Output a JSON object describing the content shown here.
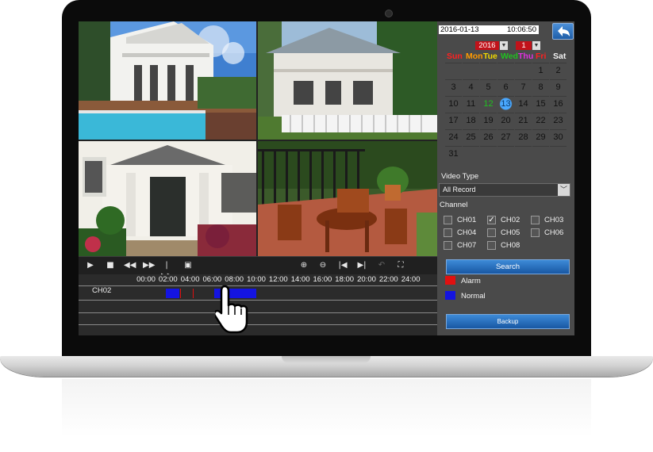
{
  "datetime": {
    "date": "2016-01-13",
    "time": "10:06:50"
  },
  "calendar": {
    "year": "2016",
    "month": "1",
    "weekdays": [
      {
        "label": "Sun",
        "color": "#ff2020"
      },
      {
        "label": "Mon",
        "color": "#ff9a00"
      },
      {
        "label": "Tue",
        "color": "#f0d800"
      },
      {
        "label": "Wed",
        "color": "#20c020"
      },
      {
        "label": "Thu",
        "color": "#e030e0"
      },
      {
        "label": "Fri",
        "color": "#ff2020"
      },
      {
        "label": "Sat",
        "color": "#f4f4f4"
      }
    ],
    "weeks": [
      [
        "",
        "",
        "",
        "",
        "",
        "1",
        "2"
      ],
      [
        "3",
        "4",
        "5",
        "6",
        "7",
        "8",
        "9"
      ],
      [
        "10",
        "11",
        "12",
        "13",
        "14",
        "15",
        "16"
      ],
      [
        "17",
        "18",
        "19",
        "20",
        "21",
        "22",
        "23"
      ],
      [
        "24",
        "25",
        "26",
        "27",
        "28",
        "29",
        "30"
      ],
      [
        "31",
        "",
        "",
        "",
        "",
        "",
        ""
      ]
    ],
    "record_day": "12",
    "record_day_color": "#20c020",
    "selected_day": "13"
  },
  "video_type": {
    "label": "Video Type",
    "value": "All Record"
  },
  "channel": {
    "label": "Channel",
    "items": [
      {
        "name": "CH01",
        "checked": false
      },
      {
        "name": "CH02",
        "checked": true
      },
      {
        "name": "CH03",
        "checked": false
      },
      {
        "name": "CH04",
        "checked": false
      },
      {
        "name": "CH05",
        "checked": false
      },
      {
        "name": "CH06",
        "checked": false
      },
      {
        "name": "CH07",
        "checked": false
      },
      {
        "name": "CH08",
        "checked": false
      }
    ]
  },
  "search_label": "Search",
  "backup_label": "Backup",
  "legend": [
    {
      "label": "Alarm",
      "color": "#e01010"
    },
    {
      "label": "Normal",
      "color": "#1414e0"
    }
  ],
  "timeline": {
    "hours": [
      "00:00",
      "02:00",
      "04:00",
      "06:00",
      "08:00",
      "10:00",
      "12:00",
      "14:00",
      "16:00",
      "18:00",
      "20:00",
      "22:00",
      "24:00"
    ],
    "channel_label": "CH02",
    "segments": [
      {
        "type": "normal",
        "start_hour": 1.8,
        "end_hour": 3.0
      },
      {
        "type": "alarm",
        "start_hour": 3.1,
        "end_hour": 4.2
      },
      {
        "type": "normal",
        "start_hour": 6.2,
        "end_hour": 10.0
      }
    ]
  },
  "controls": {
    "icons": [
      "play-icon",
      "stop-icon",
      "rewind-icon",
      "fast-forward-icon",
      "step-forward-icon",
      "snapshot-icon",
      "zoom-in-icon",
      "zoom-out-icon",
      "previous-icon",
      "next-icon",
      "return-icon",
      "fullscreen-icon"
    ]
  }
}
